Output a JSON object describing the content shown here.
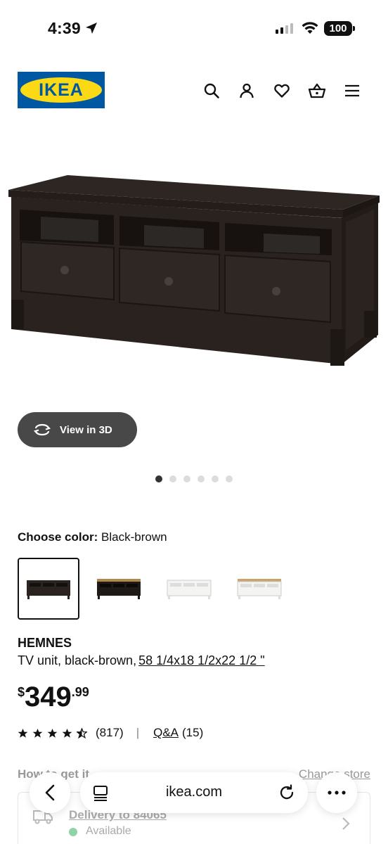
{
  "status_bar": {
    "time": "4:39",
    "battery": "100"
  },
  "header": {
    "logo": "IKEA",
    "icons": [
      "search-icon",
      "account-icon",
      "heart-icon",
      "cart-icon",
      "menu-icon"
    ]
  },
  "product": {
    "view_3d_label": "View in 3D",
    "image_count": 6,
    "active_image": 1,
    "choose_color_label": "Choose color:",
    "selected_color": "Black-brown",
    "name": "HEMNES",
    "description": "TV unit, black-brown,",
    "dimensions": "58 1/4x18 1/2x22 1/2 \"",
    "price": {
      "currency": "$",
      "integer": "349",
      "decimal": ".99"
    },
    "rating": {
      "stars": 4.5,
      "count": "(817)",
      "separator": "|",
      "qa_label": "Q&A",
      "qa_count": "(15)"
    }
  },
  "fulfillment": {
    "heading": "How to get it",
    "change_store": "Change store",
    "delivery_label": "Delivery to 84065",
    "availability": "Available"
  },
  "browser": {
    "url": "ikea.com"
  },
  "colors": {
    "ikea_blue": "#0058a3",
    "ikea_yellow": "#fbd914",
    "button_dark": "#484848",
    "available_green": "#8fd3a6"
  }
}
